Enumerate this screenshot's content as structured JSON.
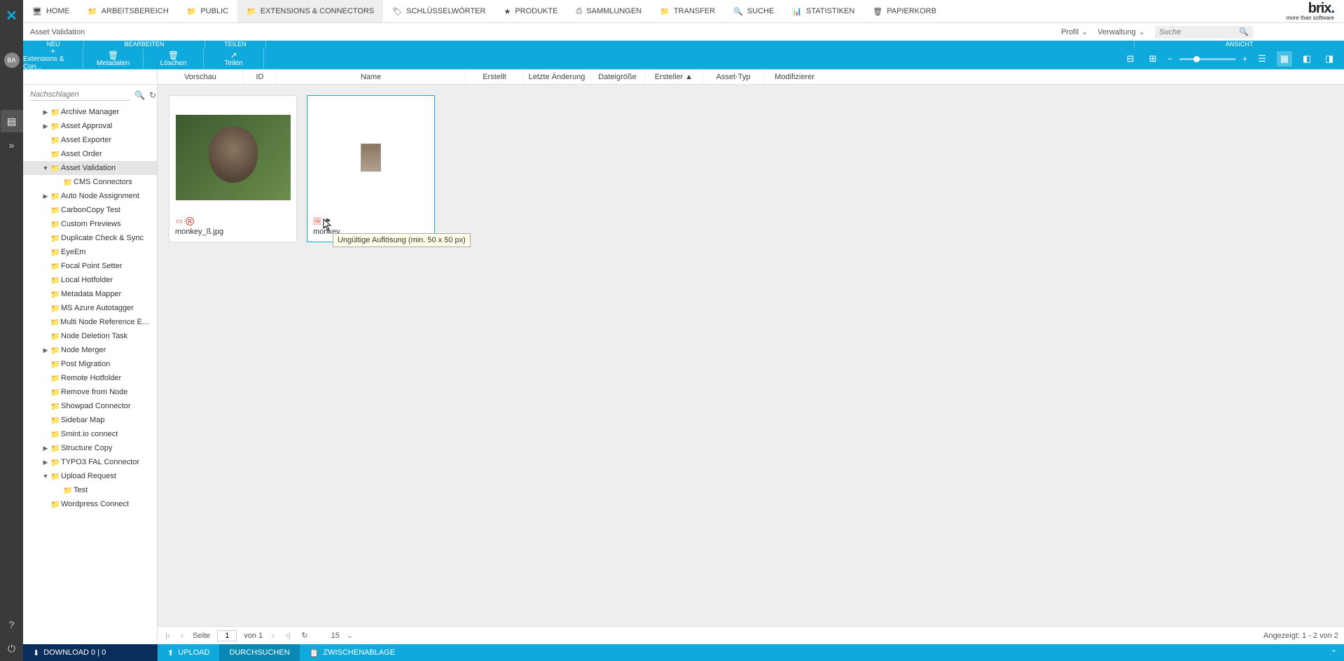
{
  "topnav": {
    "items": [
      {
        "icon": "🖥",
        "label": "HOME"
      },
      {
        "icon": "📁",
        "label": "ARBEITSBEREICH"
      },
      {
        "icon": "📁",
        "label": "PUBLIC"
      },
      {
        "icon": "📁",
        "label": "EXTENSIONS & CONNECTORS",
        "active": true
      },
      {
        "icon": "🏷",
        "label": "SCHLÜSSELWÖRTER"
      },
      {
        "icon": "★",
        "label": "PRODUKTE"
      },
      {
        "icon": "⎙",
        "label": "SAMMLUNGEN"
      },
      {
        "icon": "📁",
        "label": "TRANSFER"
      },
      {
        "icon": "🔍",
        "label": "SUCHE"
      },
      {
        "icon": "📊",
        "label": "STATISTIKEN"
      },
      {
        "icon": "🗑",
        "label": "PAPIERKORB"
      }
    ],
    "brand1": "brix",
    "brand2": "more than software"
  },
  "subbar": {
    "breadcrumb": "Asset Validation",
    "menus": [
      "Profil",
      "Verwaltung"
    ],
    "search_placeholder": "Suche"
  },
  "rowhdr": {
    "c1": "NEU",
    "c2": "BEARBEITEN",
    "c3": "TEILEN",
    "c4": "ANSICHT"
  },
  "toolbar": {
    "btns": [
      {
        "icon": "+",
        "label": "Extensions & Con..."
      },
      {
        "icon": "🗑",
        "label": "Metadaten"
      },
      {
        "icon": "🗑",
        "label": "Löschen"
      },
      {
        "icon": "↗",
        "label": "Teilen"
      }
    ]
  },
  "colhdr": [
    "Vorschau",
    "ID",
    "Name",
    "Erstellt",
    "Letzte Änderung",
    "Dateigröße",
    "Ersteller ▲",
    "Asset-Typ",
    "Modifizierer"
  ],
  "tree": {
    "search_placeholder": "Nachschlagen",
    "nodes": [
      {
        "indent": 1,
        "arr": ">",
        "label": "Archive Manager"
      },
      {
        "indent": 1,
        "arr": ">",
        "label": "Asset Approval"
      },
      {
        "indent": 1,
        "arr": "",
        "label": "Asset Exporter"
      },
      {
        "indent": 1,
        "arr": "",
        "label": "Asset Order"
      },
      {
        "indent": 1,
        "arr": "v",
        "label": "Asset Validation",
        "sel": true
      },
      {
        "indent": 2,
        "arr": "",
        "label": "CMS Connectors"
      },
      {
        "indent": 1,
        "arr": ">",
        "label": "Auto Node Assignment"
      },
      {
        "indent": 1,
        "arr": "",
        "label": "CarbonCopy Test"
      },
      {
        "indent": 1,
        "arr": "",
        "label": "Custom Previews"
      },
      {
        "indent": 1,
        "arr": "",
        "label": "Duplicate Check & Sync"
      },
      {
        "indent": 1,
        "arr": "",
        "label": "EyeEm"
      },
      {
        "indent": 1,
        "arr": "",
        "label": "Focal Point Setter"
      },
      {
        "indent": 1,
        "arr": "",
        "label": "Local Hotfolder"
      },
      {
        "indent": 1,
        "arr": "",
        "label": "Metadata Mapper"
      },
      {
        "indent": 1,
        "arr": "",
        "label": "MS Azure Autotagger"
      },
      {
        "indent": 1,
        "arr": "",
        "label": "Multi Node Reference Editor"
      },
      {
        "indent": 1,
        "arr": "",
        "label": "Node Deletion Task"
      },
      {
        "indent": 1,
        "arr": ">",
        "label": "Node Merger"
      },
      {
        "indent": 1,
        "arr": "",
        "label": "Post Migration"
      },
      {
        "indent": 1,
        "arr": "",
        "label": "Remote Hotfolder"
      },
      {
        "indent": 1,
        "arr": "",
        "label": "Remove from Node"
      },
      {
        "indent": 1,
        "arr": "",
        "label": "Showpad Connector"
      },
      {
        "indent": 1,
        "arr": "",
        "label": "Sidebar Map"
      },
      {
        "indent": 1,
        "arr": "",
        "label": "Smint.io connect"
      },
      {
        "indent": 1,
        "arr": ">",
        "label": "Structure Copy"
      },
      {
        "indent": 1,
        "arr": ">",
        "label": "TYPO3 FAL Connector"
      },
      {
        "indent": 1,
        "arr": "v",
        "label": "Upload Request"
      },
      {
        "indent": 2,
        "arr": "",
        "label": "Test"
      },
      {
        "indent": 1,
        "arr": "",
        "label": "Wordpress Connect"
      }
    ]
  },
  "assets": [
    {
      "name": "monkey_ß.jpg",
      "thumb": "large",
      "sel": false
    },
    {
      "name": "monkey.",
      "thumb": "small",
      "sel": true
    }
  ],
  "tooltip": "Ungültige Auflösung (min. 50 x 50 px)",
  "footer": {
    "page_label": "Seite",
    "page": "1",
    "of": "von 1",
    "pagesize": "15",
    "status": "Angezeigt: 1 - 2 von 2"
  },
  "bottombar": {
    "download": "DOWNLOAD   0 | 0",
    "upload": "UPLOAD",
    "browse": "DURCHSUCHEN",
    "clipboard": "ZWISCHENABLAGE"
  },
  "rail": {
    "avatar": "BA"
  }
}
